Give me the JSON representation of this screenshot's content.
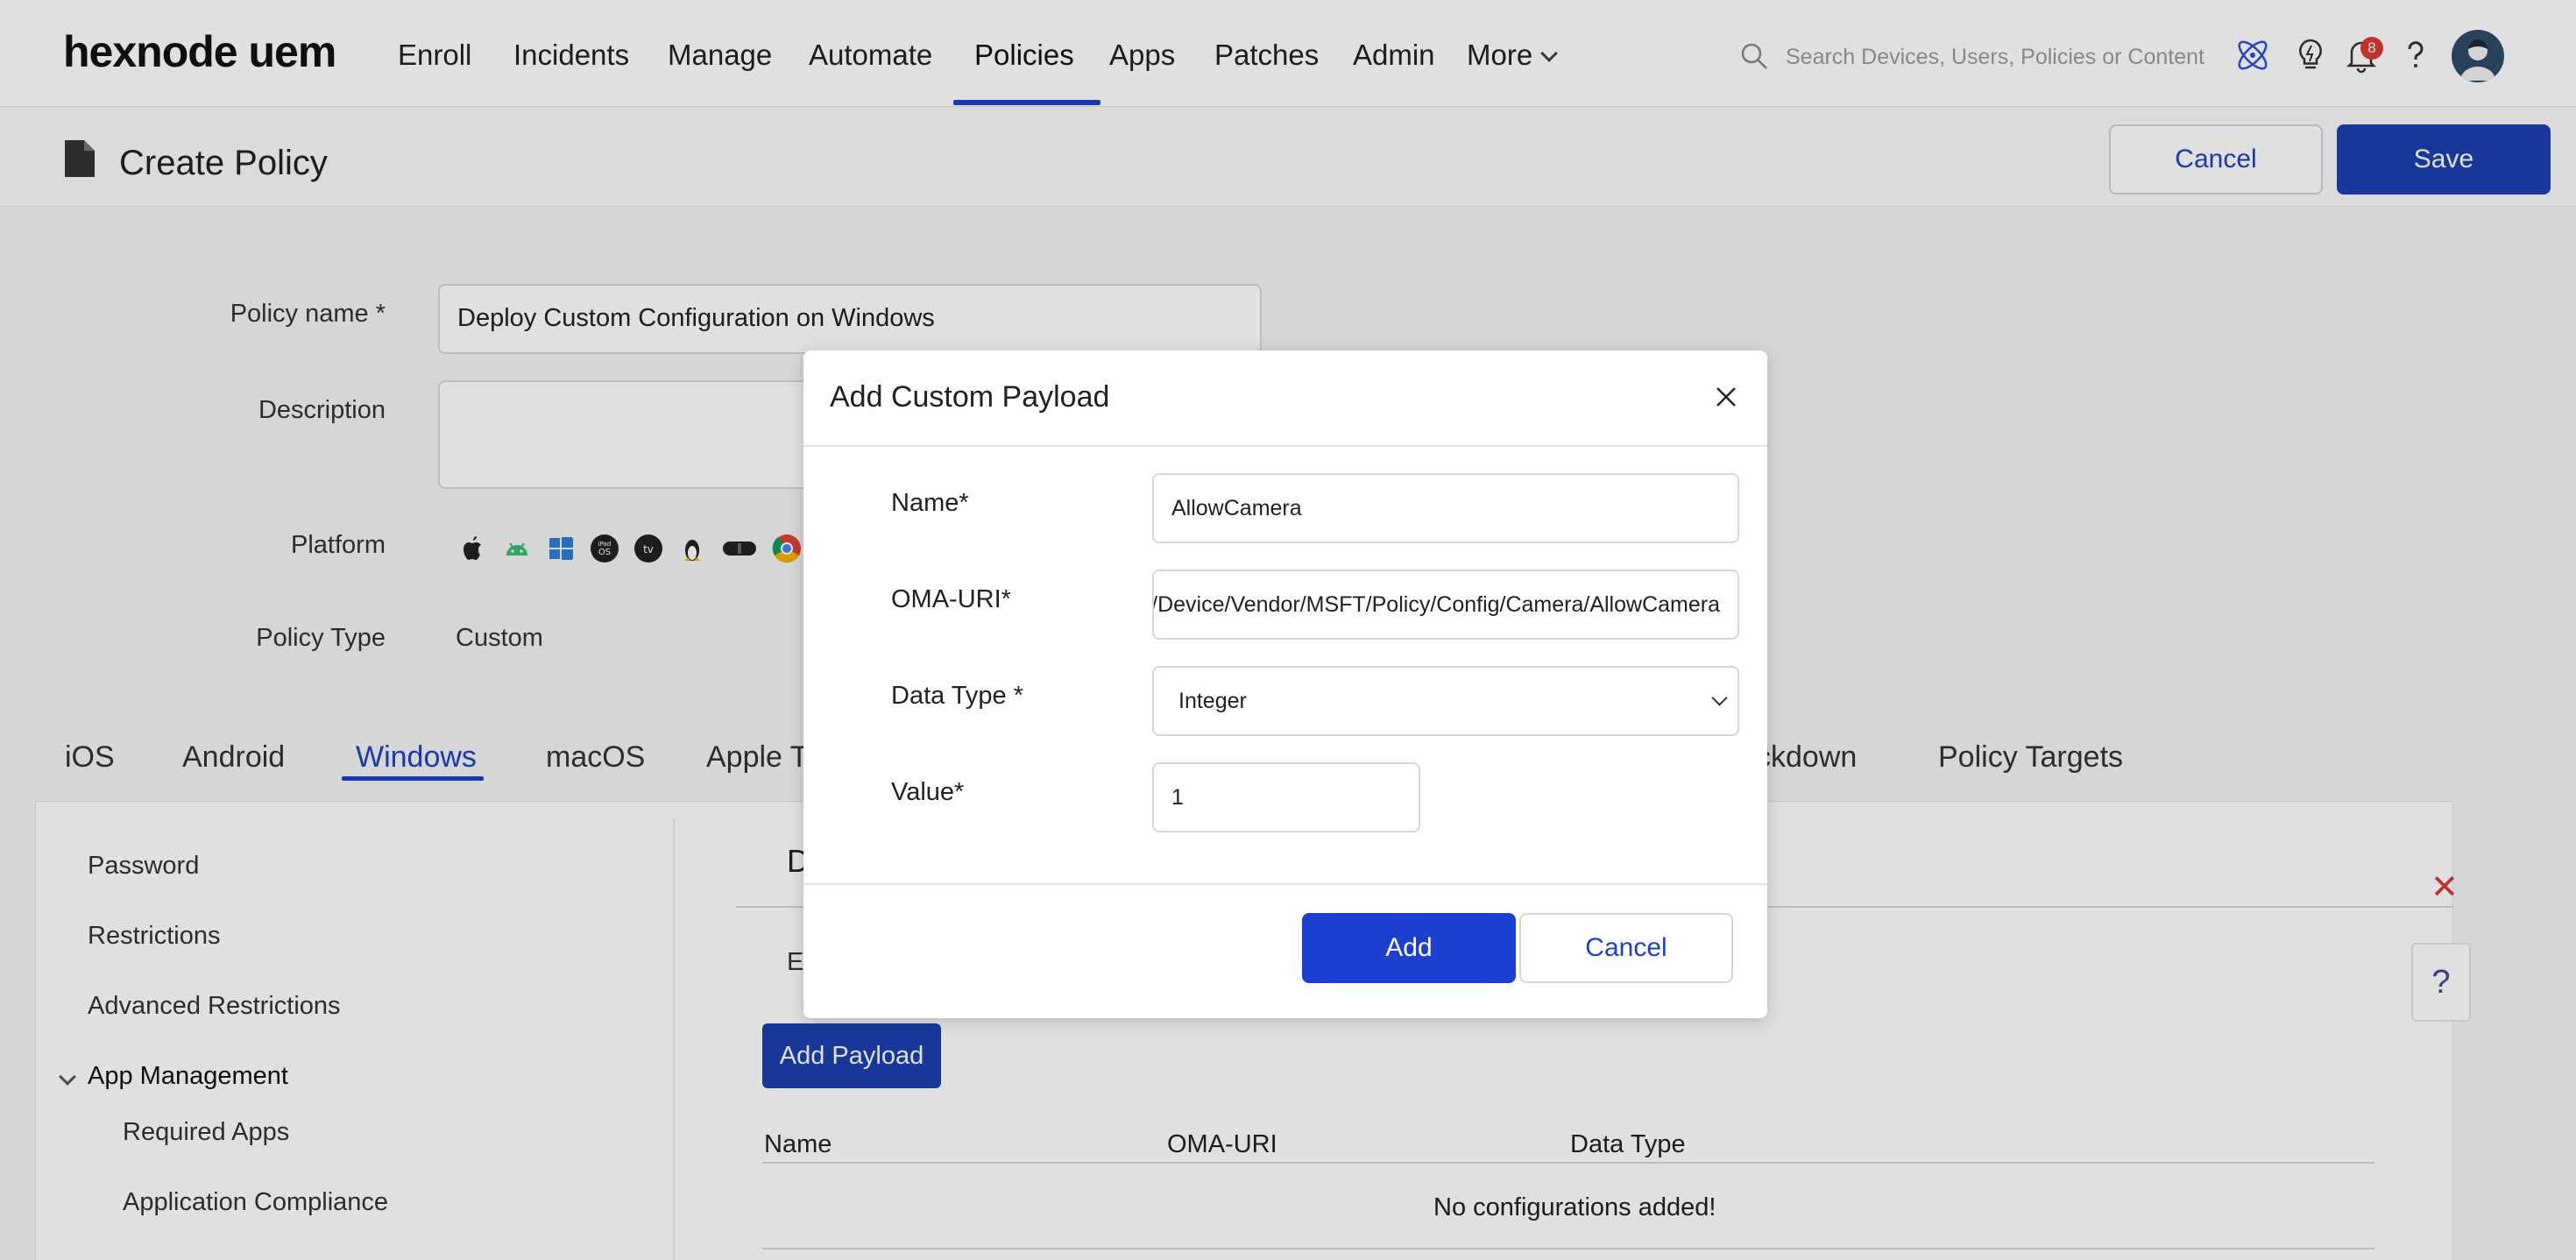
{
  "app": {
    "logo": "hexnode uem"
  },
  "nav": {
    "items": [
      "Enroll",
      "Incidents",
      "Manage",
      "Automate",
      "Policies",
      "Apps",
      "Patches",
      "Admin",
      "More"
    ],
    "active": "Policies",
    "search_placeholder": "Search Devices, Users, Policies or Content",
    "notification_count": "8"
  },
  "header": {
    "title": "Create Policy",
    "cancel_label": "Cancel",
    "save_label": "Save"
  },
  "form": {
    "policy_name_label": "Policy name *",
    "policy_name_value": "Deploy Custom Configuration on Windows",
    "description_label": "Description",
    "platform_label": "Platform",
    "platform_icons": [
      "apple-icon",
      "android-icon",
      "windows-icon",
      "visionos-icon",
      "appletv-icon",
      "linux-icon",
      "vision-pro-icon",
      "chrome-icon"
    ],
    "policy_type_label": "Policy Type",
    "policy_type_value": "Custom"
  },
  "platform_tabs": {
    "items": [
      "iOS",
      "Android",
      "Windows",
      "macOS",
      "Apple TV",
      "ckdown",
      "Policy Targets"
    ],
    "active": "Windows"
  },
  "sidebar": {
    "items": [
      "Password",
      "Restrictions",
      "Advanced Restrictions",
      "App Management",
      "Required Apps",
      "Application Compliance"
    ]
  },
  "content": {
    "section_initial": "D",
    "row_initial": "E",
    "add_payload_label": "Add Payload",
    "table_headers": [
      "Name",
      "OMA-URI",
      "Data Type"
    ],
    "empty_message": "No configurations added!",
    "help_label": "?"
  },
  "modal": {
    "title": "Add Custom Payload",
    "name_label": "Name*",
    "name_value": "AllowCamera",
    "oma_label": "OMA-URI*",
    "oma_value": "./Device/Vendor/MSFT/Policy/Config/Camera/AllowCamera",
    "datatype_label": "Data Type *",
    "datatype_value": "Integer",
    "value_label": "Value*",
    "value_value": "1",
    "add_label": "Add",
    "cancel_label": "Cancel"
  },
  "colors": {
    "accent": "#1c43c4",
    "primary_button": "#1c3fb0",
    "badge": "#d83a34"
  }
}
